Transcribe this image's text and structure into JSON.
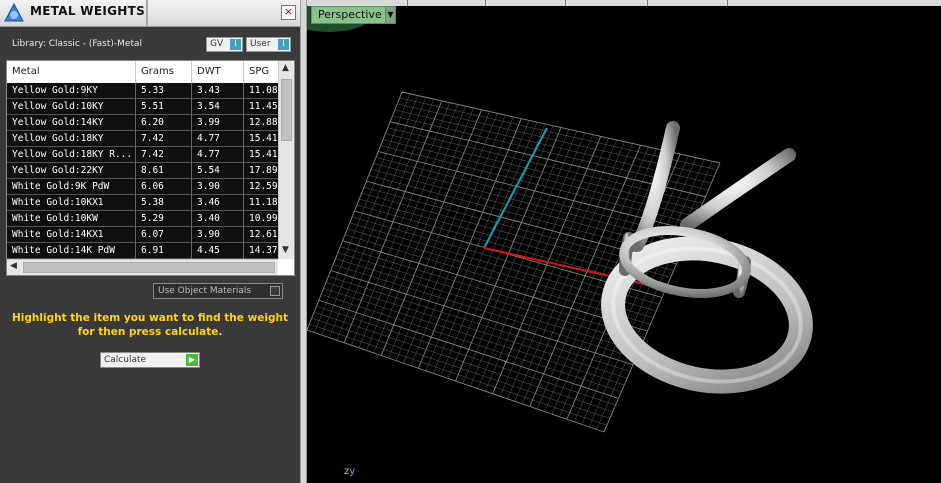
{
  "panel": {
    "title": "METAL WEIGHTS",
    "close_glyph": "×",
    "library_label": "Library: Classic - (Fast)-Metal",
    "toggles": [
      {
        "label": "GV",
        "glyph": "I"
      },
      {
        "label": "User",
        "glyph": "I"
      }
    ],
    "table": {
      "headers": [
        "Metal",
        "Grams",
        "DWT",
        "SPG"
      ],
      "rows": [
        [
          "Yellow Gold:9KY",
          "5.33",
          "3.43",
          "11.08"
        ],
        [
          "Yellow Gold:10KY",
          "5.51",
          "3.54",
          "11.45"
        ],
        [
          "Yellow Gold:14KY",
          "6.20",
          "3.99",
          "12.88"
        ],
        [
          "Yellow Gold:18KY",
          "7.42",
          "4.77",
          "15.41"
        ],
        [
          "Yellow Gold:18KY R...",
          "7.42",
          "4.77",
          "15.41"
        ],
        [
          "Yellow Gold:22KY",
          "8.61",
          "5.54",
          "17.89"
        ],
        [
          "White Gold:9K PdW",
          "6.06",
          "3.90",
          "12.59"
        ],
        [
          "White Gold:10KX1",
          "5.38",
          "3.46",
          "11.18"
        ],
        [
          "White Gold:10KW",
          "5.29",
          "3.40",
          "10.99"
        ],
        [
          "White Gold:14KX1",
          "6.07",
          "3.90",
          "12.61"
        ],
        [
          "White Gold:14K PdW",
          "6.91",
          "4.45",
          "14.37"
        ]
      ],
      "scroll_up": "▲",
      "scroll_down": "▼",
      "scroll_left": "◀",
      "scroll_right": "▶"
    },
    "use_object_materials": "Use Object Materials",
    "hint_line1": "Highlight the item you want to find the weight",
    "hint_line2": "for then press calculate.",
    "calculate_label": "Calculate",
    "calculate_glyph": "▶"
  },
  "viewport": {
    "tab_label": "Perspective",
    "dropdown_glyph": "▼",
    "axis_z": "z",
    "axis_y": "y"
  },
  "colors": {
    "grid": "#8a8a8a",
    "x_axis": "#d01818",
    "y_axis": "#19a0b0",
    "hint": "#ffd21a",
    "tab": "#8ac28f"
  }
}
